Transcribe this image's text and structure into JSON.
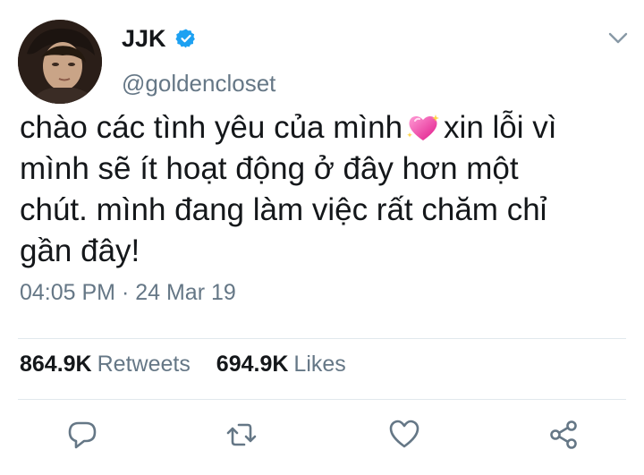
{
  "tweet": {
    "author": {
      "display_name": "JJK",
      "username": "@goldencloset",
      "verified": true
    },
    "text_parts": [
      "chào các tình yêu của mình",
      "xin lỗi vì mình sẽ ít hoạt động ở đây hơn một chút. mình đang làm việc rất chăm chỉ gần đây!"
    ],
    "emoji": "sparkling-heart",
    "timestamp": "04:05 PM · 24 Mar 19",
    "stats": {
      "retweets_count": "864.9K",
      "retweets_label": "Retweets",
      "likes_count": "694.9K",
      "likes_label": "Likes"
    },
    "actions": [
      "reply-icon",
      "retweet-icon",
      "like-icon",
      "share-icon"
    ]
  },
  "colors": {
    "text": "#14171a",
    "secondary": "#657786",
    "verified": "#1da1f2",
    "divider": "#e1e8ed"
  }
}
